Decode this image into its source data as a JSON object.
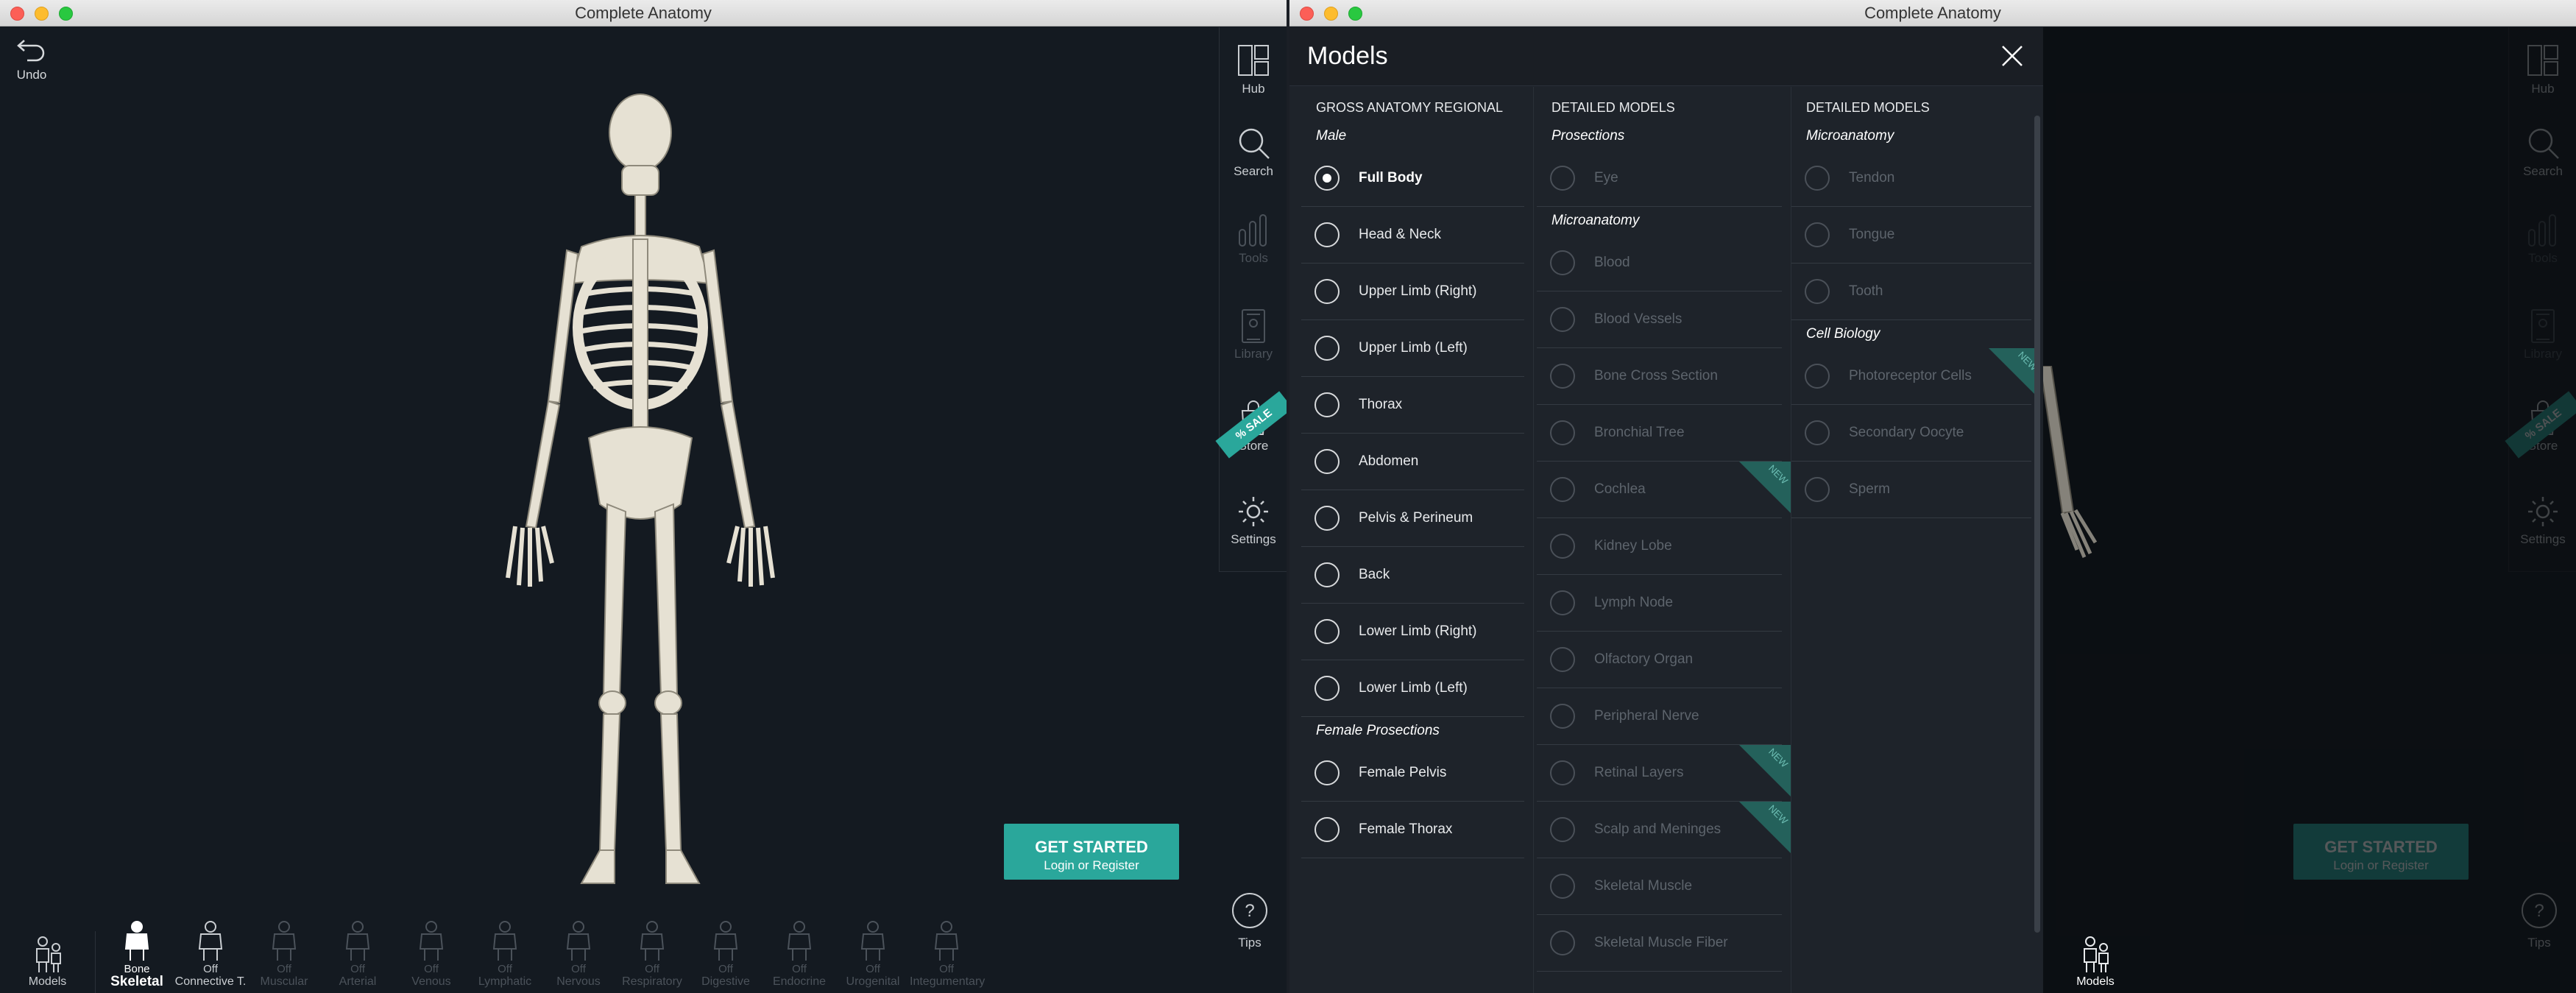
{
  "app_title": "Complete Anatomy",
  "toolbar": {
    "undo_label": "Undo",
    "right_items": [
      {
        "label": "Hub",
        "icon": "hub-icon",
        "enabled": true
      },
      {
        "label": "Search",
        "icon": "search-icon",
        "enabled": true
      },
      {
        "label": "Tools",
        "icon": "tools-icon",
        "enabled": false
      },
      {
        "label": "Library",
        "icon": "library-icon",
        "enabled": false
      },
      {
        "label": "Store",
        "icon": "store-icon",
        "enabled": true
      },
      {
        "label": "Settings",
        "icon": "gear-icon",
        "enabled": true
      }
    ],
    "sale_ribbon": "% SALE",
    "tips_label": "Tips"
  },
  "cta": {
    "title": "GET STARTED",
    "subtitle": "Login or Register",
    "color": "#2aa79b"
  },
  "bottom_bar": {
    "models_label": "Models",
    "systems": [
      {
        "state": "Bone",
        "name": "Skeletal",
        "active": true
      },
      {
        "state": "Off",
        "name": "Connective T.",
        "active": false,
        "highlighted": true
      },
      {
        "state": "Off",
        "name": "Muscular"
      },
      {
        "state": "Off",
        "name": "Arterial"
      },
      {
        "state": "Off",
        "name": "Venous"
      },
      {
        "state": "Off",
        "name": "Lymphatic"
      },
      {
        "state": "Off",
        "name": "Nervous"
      },
      {
        "state": "Off",
        "name": "Respiratory"
      },
      {
        "state": "Off",
        "name": "Digestive"
      },
      {
        "state": "Off",
        "name": "Endocrine"
      },
      {
        "state": "Off",
        "name": "Urogenital"
      },
      {
        "state": "Off",
        "name": "Integumentary"
      }
    ]
  },
  "models_panel": {
    "title": "Models",
    "columns": [
      {
        "heading": "GROSS ANATOMY REGIONAL",
        "groups": [
          {
            "name": "Male",
            "items": [
              {
                "label": "Full Body",
                "selected": true
              },
              {
                "label": "Head & Neck"
              },
              {
                "label": "Upper Limb (Right)"
              },
              {
                "label": "Upper Limb (Left)"
              },
              {
                "label": "Thorax"
              },
              {
                "label": "Abdomen"
              },
              {
                "label": "Pelvis & Perineum"
              },
              {
                "label": "Back"
              },
              {
                "label": "Lower Limb (Right)"
              },
              {
                "label": "Lower Limb (Left)"
              }
            ]
          },
          {
            "name": "Female Prosections",
            "items": [
              {
                "label": "Female Pelvis"
              },
              {
                "label": "Female Thorax"
              }
            ]
          }
        ]
      },
      {
        "heading": "DETAILED MODELS",
        "groups": [
          {
            "name": "Prosections",
            "items": [
              {
                "label": "Eye",
                "disabled": true
              }
            ]
          },
          {
            "name": "Microanatomy",
            "items": [
              {
                "label": "Blood",
                "disabled": true
              },
              {
                "label": "Blood Vessels",
                "disabled": true
              },
              {
                "label": "Bone Cross Section",
                "disabled": true
              },
              {
                "label": "Bronchial Tree",
                "disabled": true
              },
              {
                "label": "Cochlea",
                "disabled": true,
                "badge": "NEW"
              },
              {
                "label": "Kidney Lobe",
                "disabled": true
              },
              {
                "label": "Lymph Node",
                "disabled": true
              },
              {
                "label": "Olfactory Organ",
                "disabled": true
              },
              {
                "label": "Peripheral Nerve",
                "disabled": true
              },
              {
                "label": "Retinal Layers",
                "disabled": true,
                "badge": "NEW"
              },
              {
                "label": "Scalp and Meninges",
                "disabled": true,
                "badge": "NEW"
              },
              {
                "label": "Skeletal Muscle",
                "disabled": true
              },
              {
                "label": "Skeletal Muscle Fiber",
                "disabled": true
              }
            ]
          }
        ]
      },
      {
        "heading": "DETAILED MODELS",
        "groups": [
          {
            "name": "Microanatomy",
            "items": [
              {
                "label": "Tendon",
                "disabled": true
              },
              {
                "label": "Tongue",
                "disabled": true
              },
              {
                "label": "Tooth",
                "disabled": true
              }
            ]
          },
          {
            "name": "Cell Biology",
            "items": [
              {
                "label": "Photoreceptor Cells",
                "disabled": true,
                "badge": "NEW"
              },
              {
                "label": "Secondary Oocyte",
                "disabled": true
              },
              {
                "label": "Sperm",
                "disabled": true
              }
            ]
          }
        ]
      }
    ]
  }
}
